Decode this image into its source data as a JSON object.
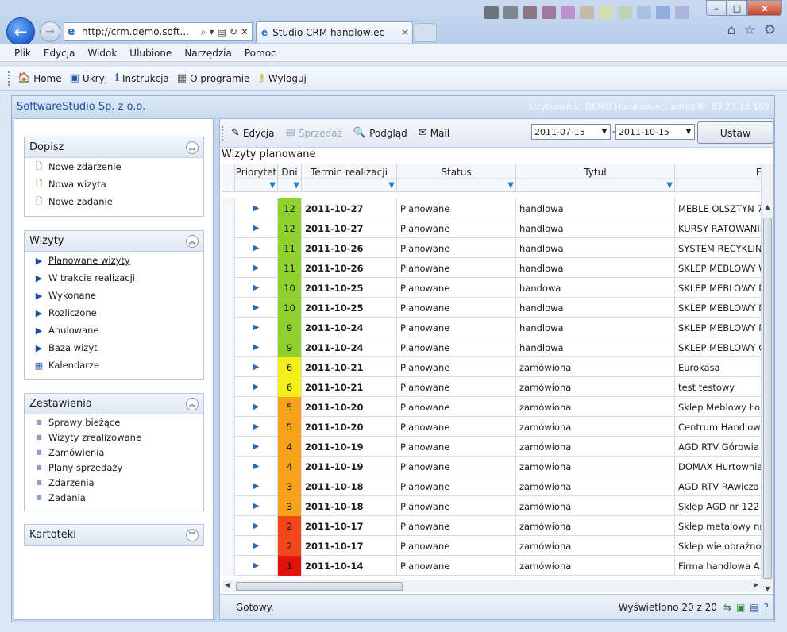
{
  "browser": {
    "url": "http://crm.demo.soft...",
    "tab_title": "Studio CRM handlowiec",
    "window_min": "–",
    "window_max": "□",
    "window_close": "x"
  },
  "menu": [
    "Plik",
    "Edycja",
    "Widok",
    "Ulubione",
    "Narzędzia",
    "Pomoc"
  ],
  "commands": [
    {
      "label": "Home",
      "icon": "home-icon"
    },
    {
      "label": "Ukryj",
      "icon": "window-icon"
    },
    {
      "label": "Instrukcja",
      "icon": "info-icon"
    },
    {
      "label": "O programie",
      "icon": "calculator-icon"
    },
    {
      "label": "Wyloguj",
      "icon": "key-icon"
    }
  ],
  "app": {
    "company": "SoftwareStudio Sp. z o.o.",
    "user_info": "Użytkownik: DEMO Handlowiec, adres IP: 83.23.18.169"
  },
  "sidebar": {
    "dopisz": {
      "title": "Dopisz",
      "items": [
        "Nowe zdarzenie",
        "Nowa wizyta",
        "Nowe zadanie"
      ]
    },
    "wizyty": {
      "title": "Wizyty",
      "items": [
        "Planowane wizyty",
        "W trakcie realizacji",
        "Wykonane",
        "Rozliczone",
        "Anulowane",
        "Baza wizyt",
        "Kalendarze"
      ]
    },
    "zestawienia": {
      "title": "Zestawienia",
      "items": [
        "Sprawy bieżące",
        "Wizyty zrealizowane",
        "Zamówienia",
        "Plany sprzedaży",
        "Zdarzenia",
        "Zadania"
      ]
    },
    "kartoteki": {
      "title": "Kartoteki"
    }
  },
  "toolbar": {
    "edit": "Edycja",
    "sale": "Sprzedaż",
    "preview": "Podgląd",
    "mail": "Mail",
    "date_from": "2011-07-15",
    "date_sep": "-",
    "date_to": "2011-10-15",
    "apply": "Ustaw"
  },
  "grid": {
    "title": "Wizyty planowane",
    "columns": [
      "Priorytet",
      "Dni",
      "Termin realizacji",
      "Status",
      "Tytuł",
      "Firma"
    ],
    "rows": [
      {
        "days": "12",
        "color": "#8fd12f",
        "date": "2011-10-27",
        "status": "Planowane",
        "title": "handlowa",
        "company": "MEBLE OLSZTYN 7"
      },
      {
        "days": "12",
        "color": "#8fd12f",
        "date": "2011-10-27",
        "status": "Planowane",
        "title": "handlowa",
        "company": "KURSY RATOWANIE"
      },
      {
        "days": "11",
        "color": "#8fd12f",
        "date": "2011-10-26",
        "status": "Planowane",
        "title": "handlowa",
        "company": "SYSTEM RECYKLING"
      },
      {
        "days": "11",
        "color": "#8fd12f",
        "date": "2011-10-26",
        "status": "Planowane",
        "title": "handlowa",
        "company": "SKLEP MEBLOWY W"
      },
      {
        "days": "10",
        "color": "#8fd12f",
        "date": "2011-10-25",
        "status": "Planowane",
        "title": "handowa",
        "company": "SKLEP MEBLOWY D"
      },
      {
        "days": "10",
        "color": "#8fd12f",
        "date": "2011-10-25",
        "status": "Planowane",
        "title": "handlowa",
        "company": "SKLEP MEBLOWY N"
      },
      {
        "days": "9",
        "color": "#8fd12f",
        "date": "2011-10-24",
        "status": "Planowane",
        "title": "handlowa",
        "company": "SKLEP MEBLOWY M"
      },
      {
        "days": "9",
        "color": "#8fd12f",
        "date": "2011-10-24",
        "status": "Planowane",
        "title": "handlowa",
        "company": "SKLEP MEBLOWY G"
      },
      {
        "days": "6",
        "color": "#f6ef1a",
        "date": "2011-10-21",
        "status": "Planowane",
        "title": "zamówiona",
        "company": "Eurokasa"
      },
      {
        "days": "6",
        "color": "#f6ef1a",
        "date": "2011-10-21",
        "status": "Planowane",
        "title": "zamówiona",
        "company": "test testowy"
      },
      {
        "days": "5",
        "color": "#f7a21b",
        "date": "2011-10-20",
        "status": "Planowane",
        "title": "zamówiona",
        "company": "Sklep Meblowy Łom"
      },
      {
        "days": "5",
        "color": "#f7a21b",
        "date": "2011-10-20",
        "status": "Planowane",
        "title": "zamówiona",
        "company": "Centrum Handlowe"
      },
      {
        "days": "4",
        "color": "#f7a21b",
        "date": "2011-10-19",
        "status": "Planowane",
        "title": "zamówiona",
        "company": "AGD RTV Górowia"
      },
      {
        "days": "4",
        "color": "#f7a21b",
        "date": "2011-10-19",
        "status": "Planowane",
        "title": "zamówiona",
        "company": "DOMAX Hurtownia"
      },
      {
        "days": "3",
        "color": "#f7a21b",
        "date": "2011-10-18",
        "status": "Planowane",
        "title": "zamówiona",
        "company": "AGD RTV RAwicza"
      },
      {
        "days": "3",
        "color": "#f7a21b",
        "date": "2011-10-18",
        "status": "Planowane",
        "title": "zamówiona",
        "company": "Sklep AGD nr 122"
      },
      {
        "days": "2",
        "color": "#f2471b",
        "date": "2011-10-17",
        "status": "Planowane",
        "title": "zamówiona",
        "company": "Sklep metalowy nr"
      },
      {
        "days": "2",
        "color": "#f2471b",
        "date": "2011-10-17",
        "status": "Planowane",
        "title": "zamówiona",
        "company": "Sklep wielobrażno"
      },
      {
        "days": "1",
        "color": "#e3120b",
        "date": "2011-10-14",
        "status": "Planowane",
        "title": "zamówiona",
        "company": "Firma handlowa A"
      }
    ]
  },
  "status": {
    "ready": "Gotowy.",
    "count": "Wyświetlono 20 z 20"
  }
}
